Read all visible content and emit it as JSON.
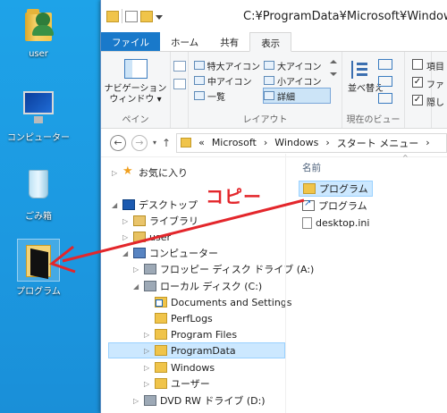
{
  "desktop": {
    "icons": [
      {
        "label": "user",
        "icon": "user-folder-icon"
      },
      {
        "label": "コンピューター",
        "icon": "computer-icon"
      },
      {
        "label": "ごみ箱",
        "icon": "recycle-bin-icon"
      },
      {
        "label": "プログラム",
        "icon": "folder-icon"
      }
    ]
  },
  "window": {
    "title": "C:¥ProgramData¥Microsoft¥Window",
    "tabs": [
      "ファイル",
      "ホーム",
      "共有",
      "表示"
    ],
    "active_tab": "表示",
    "ribbon": {
      "pane_group": {
        "button": "ナビゲーション\nウィンドウ ▾",
        "caption": "ペイン"
      },
      "layout_group": {
        "caption": "レイアウト",
        "options": [
          "特大アイコン",
          "大アイコン",
          "中アイコン",
          "小アイコン",
          "一覧",
          "詳細"
        ],
        "selected": "詳細"
      },
      "current_view_group": {
        "sort_button": "並べ替え",
        "caption": "現在のビュー"
      },
      "show_group": {
        "items": [
          {
            "label": "項目",
            "checked": false
          },
          {
            "label": "ファ",
            "checked": true
          },
          {
            "label": "隠し",
            "checked": true
          }
        ]
      }
    },
    "address": {
      "back": "←",
      "forward": "→",
      "up": "↑",
      "breadcrumb": [
        "«",
        "Microsoft",
        "›",
        "Windows",
        "›",
        "スタート メニュー",
        "›"
      ]
    },
    "nav_tree": [
      {
        "label": "お気に入り",
        "icon": "star-icon",
        "expander": "▷"
      },
      {
        "label": "デスクトップ",
        "icon": "desktop-icon",
        "expander": "◢"
      },
      {
        "label": "ライブラリ",
        "icon": "library-icon",
        "expander": "▷"
      },
      {
        "label": "user",
        "icon": "user-icon",
        "expander": "▷"
      },
      {
        "label": "コンピューター",
        "icon": "computer-icon",
        "expander": "◢"
      },
      {
        "label": "フロッピー ディスク ドライブ (A:)",
        "icon": "floppy-icon",
        "expander": "▷"
      },
      {
        "label": "ローカル ディスク (C:)",
        "icon": "drive-icon",
        "expander": "◢"
      },
      {
        "label": "Documents and Settings",
        "icon": "folder-shortcut-icon",
        "expander": ""
      },
      {
        "label": "PerfLogs",
        "icon": "folder-icon",
        "expander": ""
      },
      {
        "label": "Program Files",
        "icon": "folder-icon",
        "expander": "▷"
      },
      {
        "label": "ProgramData",
        "icon": "folder-icon",
        "expander": "▷"
      },
      {
        "label": "Windows",
        "icon": "folder-icon",
        "expander": "▷"
      },
      {
        "label": "ユーザー",
        "icon": "folder-icon",
        "expander": "▷"
      },
      {
        "label": "DVD RW ドライブ (D:)",
        "icon": "dvd-drive-icon",
        "expander": "▷"
      }
    ],
    "nav_selected": "ProgramData",
    "file_list": {
      "column_header": "名前",
      "sort_indicator": "^",
      "items": [
        {
          "label": "プログラム",
          "icon": "folder-icon",
          "selected": true
        },
        {
          "label": "プログラム",
          "icon": "shortcut-icon",
          "selected": false
        },
        {
          "label": "desktop.ini",
          "icon": "ini-file-icon",
          "selected": false
        }
      ]
    }
  },
  "annotation": {
    "text": "コピー",
    "color": "#e3262b"
  },
  "colors": {
    "desktop": "#1c98e0",
    "file_tab": "#1979ca",
    "selection": "#cce8ff"
  }
}
